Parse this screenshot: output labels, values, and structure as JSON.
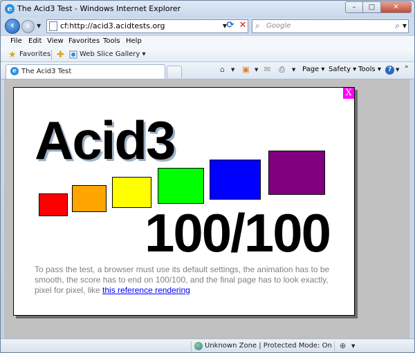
{
  "window": {
    "title": "The Acid3 Test - Windows Internet Explorer",
    "minimize": "–",
    "maximize": "□",
    "close": "✕"
  },
  "address_bar": {
    "url": "cf:http://acid3.acidtests.org"
  },
  "search": {
    "placeholder": "Google"
  },
  "menu": {
    "items": [
      "File",
      "Edit",
      "View",
      "Favorites",
      "Tools",
      "Help"
    ]
  },
  "favorites_bar": {
    "favorites_label": "Favorites",
    "web_slice_label": "Web Slice Gallery"
  },
  "tab": {
    "label": "The Acid3 Test"
  },
  "command_bar": {
    "page": "Page",
    "safety": "Safety",
    "tools": "Tools",
    "help": "?"
  },
  "acid3": {
    "close_label": "X",
    "title": "Acid3",
    "score": "100/100",
    "description_text": "To pass the test, a browser must use its default settings, the animation has to be smooth, the score has to end on 100/100, and the final page has to look exactly, pixel for pixel, like ",
    "link_text": "this reference rendering",
    "colors": {
      "red": "#ff0000",
      "orange": "#ffa500",
      "yellow": "#ffff00",
      "lime": "#00ff00",
      "blue": "#0000ff",
      "purple": "#800080",
      "close_bg": "#ff00ff"
    }
  },
  "status_bar": {
    "zone": "Unknown Zone | Protected Mode: On"
  }
}
